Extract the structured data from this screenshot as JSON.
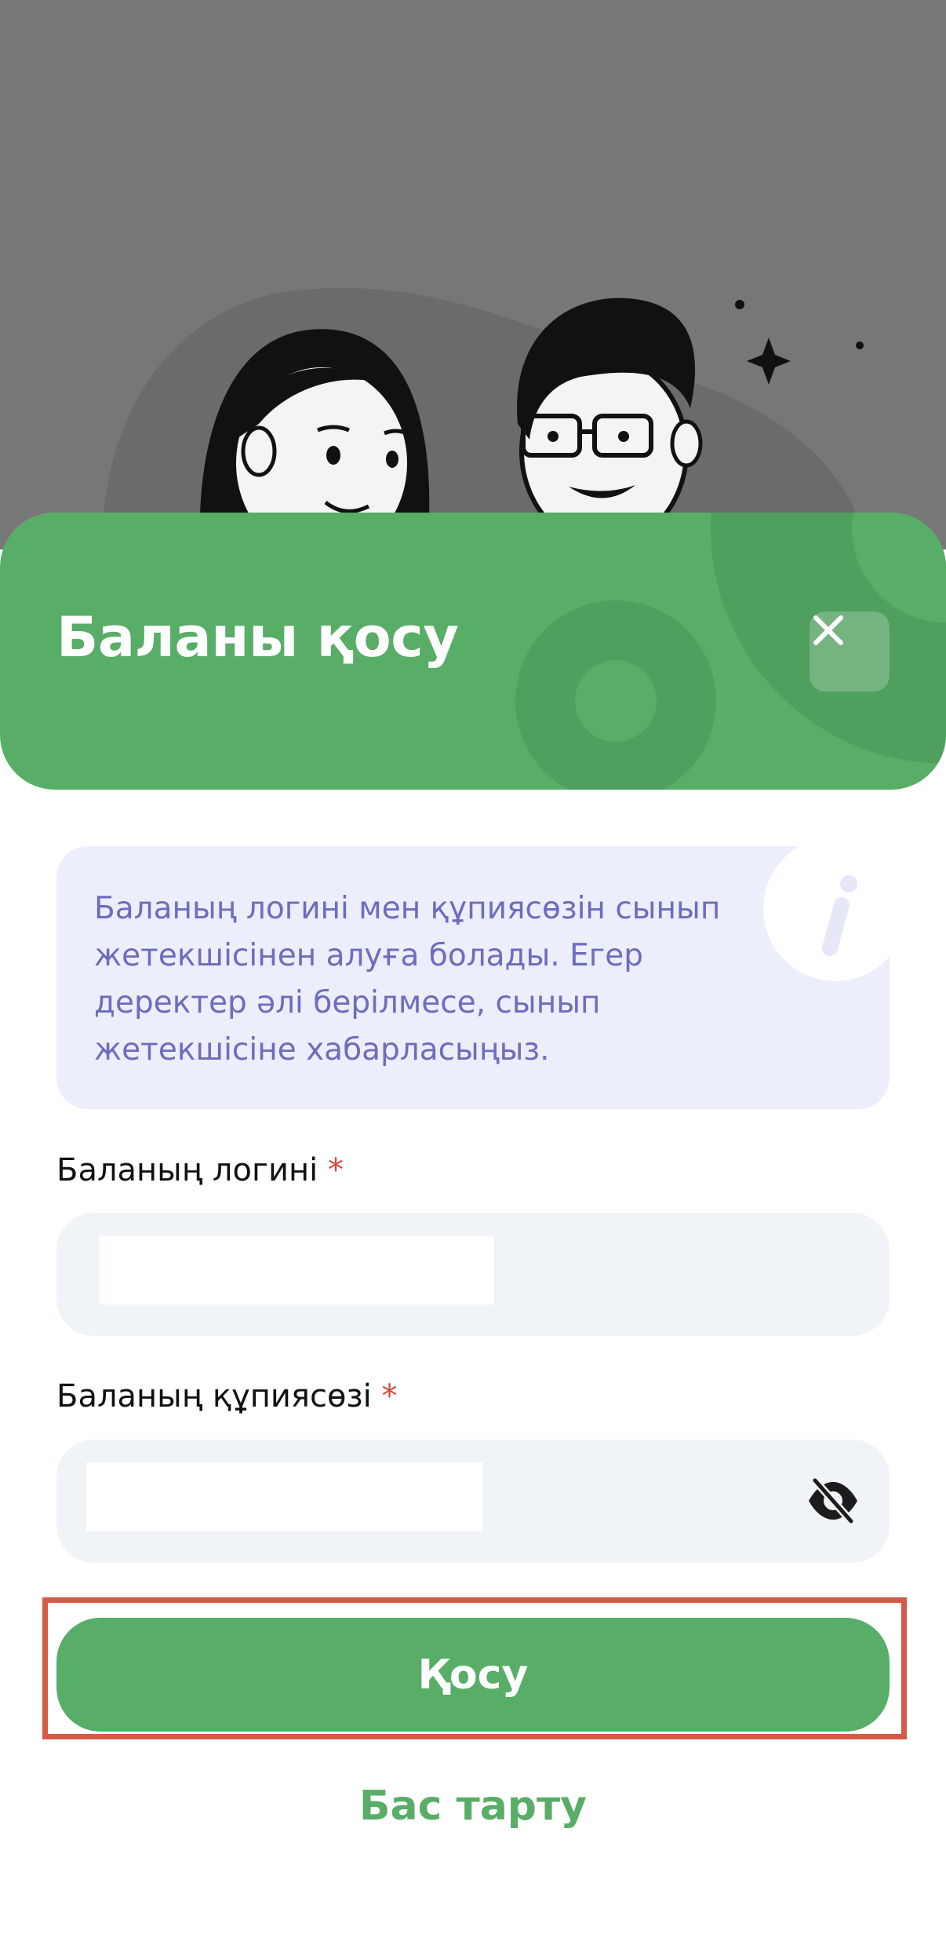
{
  "dialog": {
    "title": "Баланы қосу",
    "close_icon": "close-icon"
  },
  "info": {
    "text": "Баланың логині мен құпиясөзін сынып жетекшісінен алуға болады. Егер деректер әлі берілмесе, сынып жетекшісіне хабарласыңыз.",
    "icon": "info-icon"
  },
  "form": {
    "login": {
      "label": "Баланың логині",
      "required_mark": "*",
      "value": ""
    },
    "password": {
      "label": "Баланың құпиясөзі",
      "required_mark": "*",
      "value": "",
      "toggle_icon": "eye-off-icon"
    }
  },
  "actions": {
    "submit_label": "Қосу",
    "cancel_label": "Бас тарту"
  },
  "colors": {
    "primary": "#58ad67",
    "info_bg": "#eceefb",
    "info_text": "#6c6dbd",
    "required": "#d9453a",
    "input_bg": "#f0f3f7"
  }
}
